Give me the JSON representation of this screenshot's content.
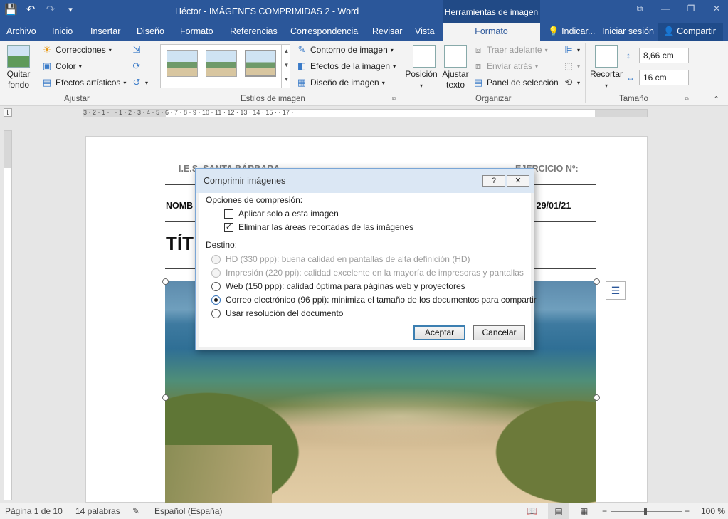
{
  "titlebar": {
    "document_title": "Héctor - IMÁGENES COMPRIMIDAS 2 - Word",
    "tools_context": "Herramientas de imagen",
    "qat": {
      "save": "💾",
      "undo": "↶",
      "redo": "↷",
      "customize": "▾"
    },
    "window": {
      "restore_ribbon": "⧉",
      "minimize": "—",
      "maximize": "❐",
      "close": "✕"
    }
  },
  "tabs": [
    "Archivo",
    "Inicio",
    "Insertar",
    "Diseño",
    "Formato",
    "Referencias",
    "Correspondencia",
    "Revisar",
    "Vista"
  ],
  "active_tab": "Formato",
  "tell_me": "Indicar...",
  "sign_in": "Iniciar sesión",
  "share": "Compartir",
  "ribbon": {
    "ajustar": {
      "label": "Ajustar",
      "quitar_fondo": "Quitar fondo",
      "correcciones": "Correcciones",
      "color": "Color",
      "efectos_artisticos": "Efectos artísticos"
    },
    "estilos": {
      "label": "Estilos de imagen",
      "contorno": "Contorno de imagen",
      "efectos": "Efectos de la imagen",
      "diseno": "Diseño de imagen"
    },
    "organizar": {
      "label": "Organizar",
      "posicion": "Posición",
      "ajustar_texto": "Ajustar texto",
      "traer_adelante": "Traer adelante",
      "enviar_atras": "Enviar atrás",
      "panel_seleccion": "Panel de selección"
    },
    "tamano": {
      "label": "Tamaño",
      "recortar": "Recortar",
      "alto": "8,66 cm",
      "ancho": "16 cm"
    }
  },
  "ruler": "3 · 2 · 1 · · · 1 · 2 · 3 · 4 · 5 · 6 · 7 · 8 · 9 · 10 · 11 · 12 · 13 · 14 · 15 · · 17 ·",
  "document": {
    "school": "I.E.S. SANTA BÁRBARA",
    "exercise": "EJERCICIO Nº:",
    "name_label": "NOMB",
    "date": ": 29/01/21",
    "title_partial": "TÍT"
  },
  "dialog": {
    "title": "Comprimir imágenes",
    "help": "?",
    "close": "✕",
    "compression_section": "Opciones de compresión:",
    "apply_only": "Aplicar solo a esta imagen",
    "apply_only_checked": false,
    "delete_cropped": "Eliminar las áreas recortadas de las imágenes",
    "delete_cropped_checked": true,
    "target_section": "Destino:",
    "options": [
      {
        "label": "HD (330 ppp): buena calidad en pantallas de alta definición (HD)",
        "enabled": false,
        "selected": false
      },
      {
        "label": "Impresión (220 ppi): calidad excelente en la mayoría de impresoras y pantallas",
        "enabled": false,
        "selected": false
      },
      {
        "label": "Web (150 ppp): calidad óptima para páginas web y proyectores",
        "enabled": true,
        "selected": false
      },
      {
        "label": "Correo electrónico (96 ppi): minimiza el tamaño de los documentos para compartir",
        "enabled": true,
        "selected": true
      },
      {
        "label": "Usar resolución del documento",
        "enabled": true,
        "selected": false
      }
    ],
    "ok": "Aceptar",
    "cancel": "Cancelar"
  },
  "status": {
    "page": "Página 1 de 10",
    "words": "14 palabras",
    "language": "Español (España)",
    "zoom": "100 %",
    "zoom_minus": "−",
    "zoom_plus": "+"
  }
}
